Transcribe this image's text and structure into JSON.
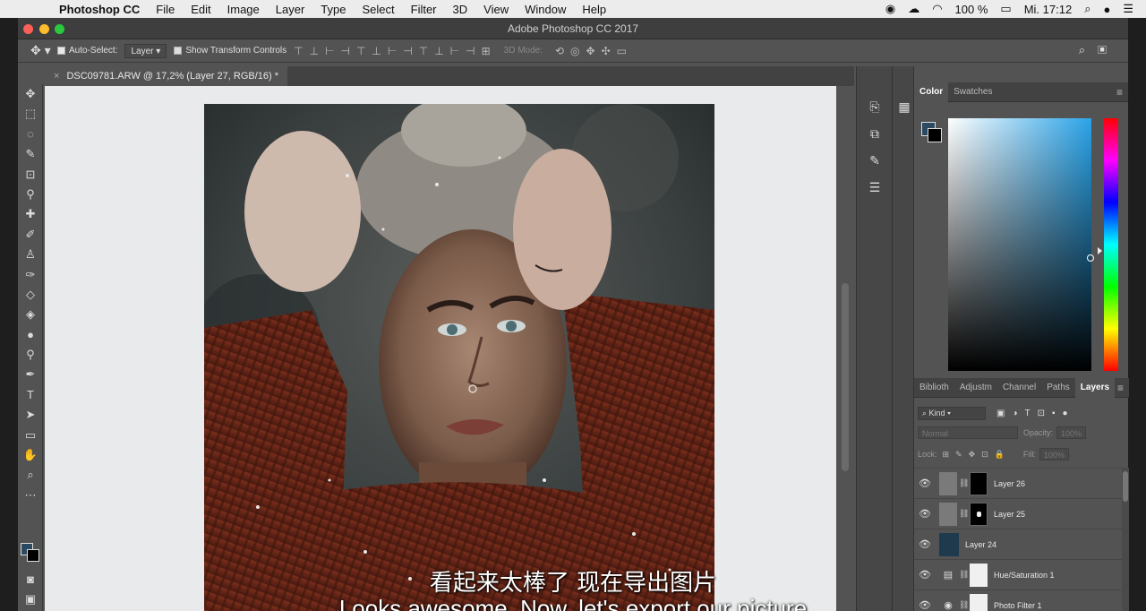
{
  "menubar": {
    "app_name": "Photoshop CC",
    "items": [
      "File",
      "Edit",
      "Image",
      "Layer",
      "Type",
      "Select",
      "Filter",
      "3D",
      "View",
      "Window",
      "Help"
    ],
    "battery": "100 %",
    "clock": "Mi. 17:12"
  },
  "window": {
    "title": "Adobe Photoshop CC 2017"
  },
  "options_bar": {
    "auto_select_label": "Auto-Select:",
    "auto_select_value": "Layer",
    "transform_label": "Show Transform Controls",
    "mode_3d_label": "3D Mode:"
  },
  "document": {
    "tab_title": "DSC09781.ARW @ 17,2% (Layer 27, RGB/16) *"
  },
  "color_panel": {
    "tabs": [
      "Color",
      "Swatches"
    ],
    "foreground": "#2b4a62",
    "background": "#000000"
  },
  "layers_panel": {
    "tabs": [
      "Biblioth",
      "Adjustm",
      "Channel",
      "Paths",
      "Layers"
    ],
    "kind_label": "Kind",
    "blend_mode": "Normal",
    "opacity_label": "Opacity:",
    "opacity_value": "100%",
    "lock_label": "Lock:",
    "fill_label": "Fill:",
    "fill_value": "100%",
    "layers": [
      {
        "name": "Layer 26",
        "type": "pixel-mask"
      },
      {
        "name": "Layer 25",
        "type": "pixel-mask"
      },
      {
        "name": "Layer 24",
        "type": "fill"
      },
      {
        "name": "Hue/Saturation 1",
        "type": "adjustment"
      },
      {
        "name": "Photo Filter 1",
        "type": "adjustment"
      }
    ]
  },
  "subtitles": {
    "chinese": "看起来太棒了 现在导出图片",
    "english": "Looks awesome. Now, let's export our picture"
  }
}
